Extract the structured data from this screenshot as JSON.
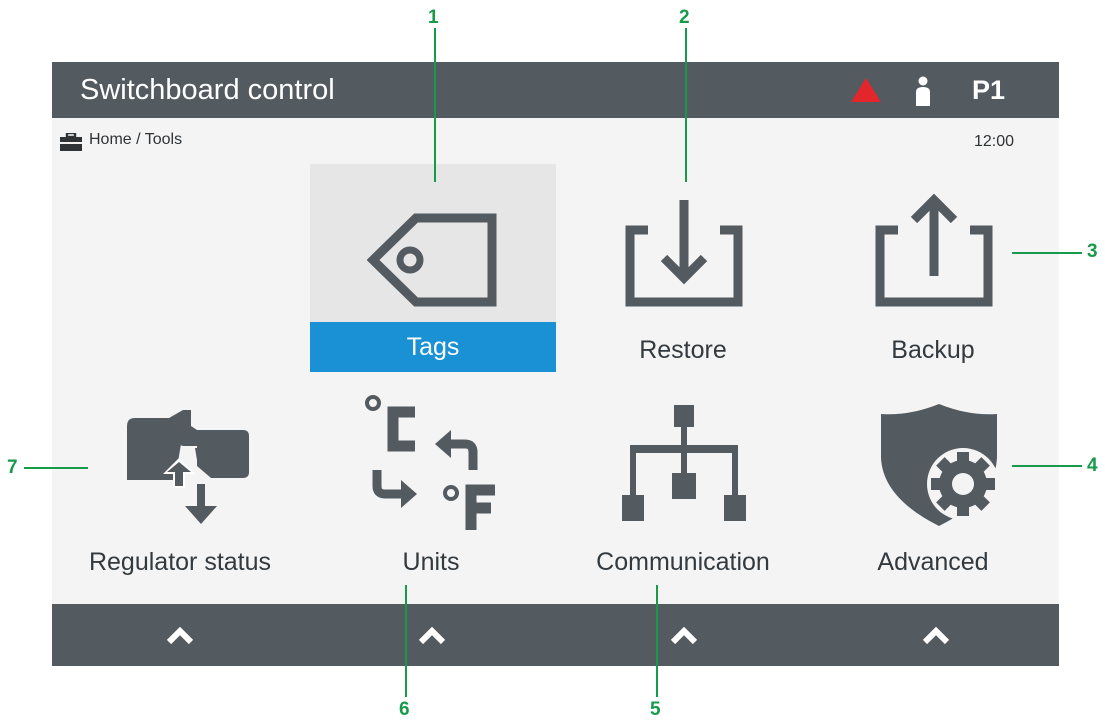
{
  "header": {
    "title": "Switchboard control",
    "profile": "P1",
    "alert_icon": "warning-triangle-icon",
    "user_icon": "user-icon"
  },
  "breadcrumb": {
    "icon": "toolbox-icon",
    "path": "Home / Tools",
    "time": "12:00"
  },
  "tiles": [
    {
      "label": "Tags",
      "icon": "tag-icon",
      "selected": true
    },
    {
      "label": "Restore",
      "icon": "download-tray-icon"
    },
    {
      "label": "Backup",
      "icon": "upload-tray-icon"
    },
    {
      "label": "Regulator status",
      "icon": "regulator-status-icon"
    },
    {
      "label": "Units",
      "icon": "unit-conversion-icon"
    },
    {
      "label": "Communication",
      "icon": "network-icon"
    },
    {
      "label": "Advanced",
      "icon": "shield-gear-icon"
    }
  ],
  "footer": {
    "buttons": [
      "chevron-up-icon",
      "chevron-up-icon",
      "chevron-up-icon",
      "chevron-up-icon"
    ]
  },
  "callouts": [
    "1",
    "2",
    "3",
    "4",
    "5",
    "6",
    "7"
  ],
  "colors": {
    "bar": "#535a60",
    "background": "#f4f4f4",
    "selected_label": "#1a90d5",
    "alert": "#e3262b",
    "callout": "#179a4a",
    "icon": "#535a60"
  }
}
